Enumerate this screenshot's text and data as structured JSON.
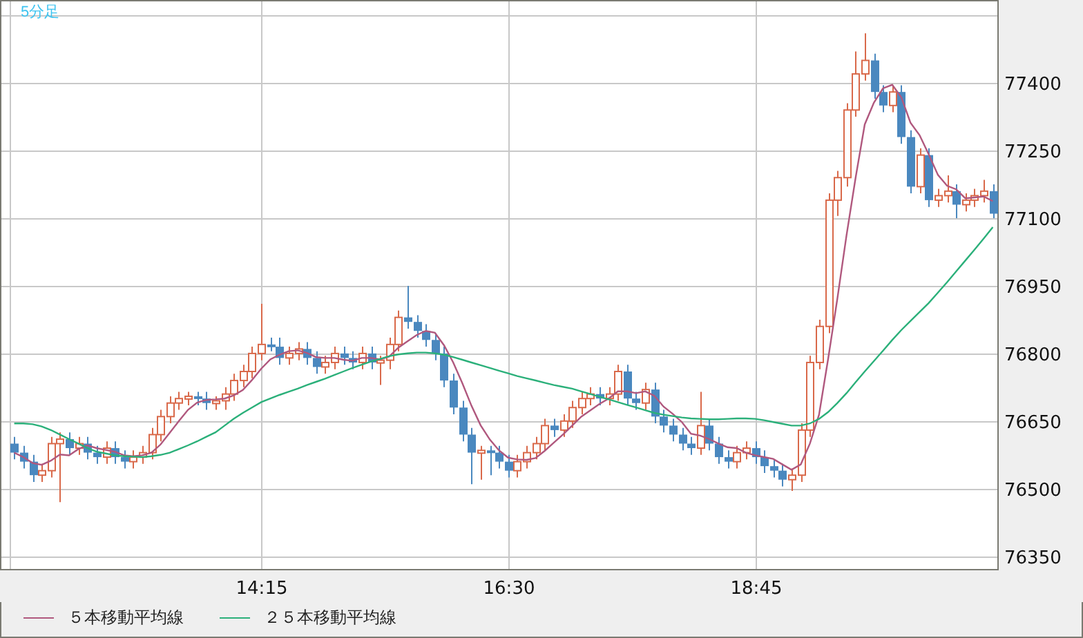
{
  "timeframe": "5分足",
  "chart_data": {
    "type": "candlestick",
    "grid": true,
    "ylim": [
      76322,
      77584
    ],
    "yticks": [
      76350,
      76500,
      76650,
      76800,
      76950,
      77100,
      77250,
      77400
    ],
    "categories": [
      null,
      null,
      null,
      null,
      null,
      null,
      null,
      null,
      null,
      null,
      null,
      null,
      null,
      null,
      null,
      null,
      null,
      null,
      null,
      null,
      null,
      null,
      null,
      null,
      null,
      null,
      null,
      "14:15",
      null,
      null,
      null,
      null,
      null,
      null,
      null,
      null,
      null,
      null,
      null,
      null,
      null,
      null,
      null,
      null,
      null,
      null,
      null,
      null,
      null,
      null,
      null,
      null,
      null,
      null,
      "16:30",
      null,
      null,
      null,
      null,
      null,
      null,
      null,
      null,
      null,
      null,
      null,
      null,
      null,
      null,
      null,
      null,
      null,
      null,
      null,
      null,
      null,
      null,
      null,
      null,
      null,
      null,
      "18:45",
      null,
      null,
      null,
      null,
      null,
      null,
      null,
      null,
      null,
      null,
      null,
      null,
      null,
      null,
      null,
      null,
      null,
      null,
      null,
      null,
      null,
      null,
      null,
      null,
      null,
      null
    ],
    "series": [
      {
        "name": "５本移動平均線",
        "type": "line",
        "color": "#b0587e",
        "values": [
          76580,
          76570,
          76557,
          76553,
          76562,
          76576,
          76574,
          76588,
          76596,
          76590,
          76586,
          76582,
          76574,
          76572,
          76574,
          76580,
          76598,
          76624,
          76650,
          76675,
          76691,
          76697,
          76698,
          76700,
          76707,
          76719,
          76741,
          76766,
          76787,
          76797,
          76805,
          76807,
          76801,
          76792,
          76790,
          76790,
          76786,
          76784,
          76790,
          76790,
          76787,
          76793,
          76813,
          76827,
          76841,
          76850,
          76846,
          76818,
          76780,
          76734,
          76684,
          76641,
          76609,
          76585,
          76569,
          76565,
          76564,
          76568,
          76584,
          76602,
          76620,
          76640,
          76660,
          76674,
          76688,
          76700,
          76716,
          76716,
          76712,
          76716,
          76706,
          76682,
          76666,
          76648,
          76622,
          76618,
          76610,
          76600,
          76592,
          76590,
          76580,
          76574,
          76570,
          76566,
          76554,
          76542,
          76554,
          76600,
          76664,
          76788,
          76920,
          77062,
          77190,
          77308,
          77356,
          77388,
          77396,
          77368,
          77312,
          77284,
          77242,
          77196,
          77172,
          77164,
          77144,
          77146,
          77148,
          77138
        ]
      },
      {
        "name": "２５本移動平均線",
        "type": "line",
        "color": "#2bb07a",
        "values": [
          76645,
          76645,
          76643,
          76638,
          76630,
          76620,
          76610,
          76600,
          76590,
          76582,
          76578,
          76574,
          76572,
          76571,
          76570,
          76572,
          76575,
          76580,
          76588,
          76596,
          76605,
          76615,
          76625,
          76640,
          76655,
          76668,
          76680,
          76692,
          76700,
          76708,
          76715,
          76722,
          76730,
          76737,
          76744,
          76752,
          76760,
          76768,
          76775,
          76782,
          76788,
          76794,
          76798,
          76800,
          76802,
          76802,
          76800,
          76797,
          76792,
          76786,
          76780,
          76774,
          76768,
          76762,
          76756,
          76750,
          76745,
          76740,
          76735,
          76730,
          76726,
          76722,
          76716,
          76710,
          76704,
          76698,
          76692,
          76686,
          76680,
          76674,
          76668,
          76664,
          76661,
          76658,
          76656,
          76655,
          76654,
          76654,
          76655,
          76656,
          76656,
          76655,
          76652,
          76648,
          76644,
          76640,
          76640,
          76645,
          76655,
          76670,
          76690,
          76712,
          76736,
          76760,
          76783,
          76806,
          76830,
          76852,
          76872,
          76892,
          76912,
          76935,
          76958,
          76982,
          77006,
          77030,
          77055,
          77080
        ]
      }
    ],
    "ohlc": [
      [
        76600,
        76615,
        76565,
        76580
      ],
      [
        76580,
        76595,
        76545,
        76560
      ],
      [
        76560,
        76575,
        76515,
        76530
      ],
      [
        76530,
        76555,
        76515,
        76540
      ],
      [
        76540,
        76615,
        76525,
        76600
      ],
      [
        76600,
        76625,
        76470,
        76610
      ],
      [
        76610,
        76625,
        76575,
        76590
      ],
      [
        76590,
        76615,
        76575,
        76600
      ],
      [
        76600,
        76615,
        76565,
        76580
      ],
      [
        76580,
        76595,
        76555,
        76570
      ],
      [
        76570,
        76605,
        76555,
        76590
      ],
      [
        76590,
        76605,
        76555,
        76570
      ],
      [
        76570,
        76585,
        76545,
        76560
      ],
      [
        76560,
        76585,
        76545,
        76570
      ],
      [
        76570,
        76595,
        76555,
        76580
      ],
      [
        76580,
        76635,
        76565,
        76620
      ],
      [
        76620,
        76675,
        76605,
        76660
      ],
      [
        76660,
        76705,
        76645,
        76690
      ],
      [
        76690,
        76715,
        76675,
        76700
      ],
      [
        76700,
        76715,
        76685,
        76705
      ],
      [
        76705,
        76715,
        76685,
        76700
      ],
      [
        76700,
        76715,
        76675,
        76690
      ],
      [
        76690,
        76705,
        76675,
        76695
      ],
      [
        76695,
        76725,
        76675,
        76710
      ],
      [
        76710,
        76755,
        76695,
        76740
      ],
      [
        76740,
        76775,
        76725,
        76760
      ],
      [
        76760,
        76815,
        76745,
        76800
      ],
      [
        76800,
        76910,
        76785,
        76820
      ],
      [
        76820,
        76835,
        76805,
        76815
      ],
      [
        76815,
        76835,
        76775,
        76790
      ],
      [
        76790,
        76815,
        76775,
        76800
      ],
      [
        76800,
        76825,
        76785,
        76810
      ],
      [
        76810,
        76825,
        76775,
        76790
      ],
      [
        76790,
        76805,
        76755,
        76770
      ],
      [
        76770,
        76795,
        76755,
        76780
      ],
      [
        76780,
        76815,
        76765,
        76800
      ],
      [
        76800,
        76815,
        76775,
        76790
      ],
      [
        76790,
        76805,
        76765,
        76780
      ],
      [
        76780,
        76815,
        76765,
        76800
      ],
      [
        76800,
        76815,
        76765,
        76780
      ],
      [
        76780,
        76795,
        76730,
        76785
      ],
      [
        76785,
        76835,
        76765,
        76820
      ],
      [
        76820,
        76895,
        76805,
        76880
      ],
      [
        76880,
        76950,
        76855,
        76870
      ],
      [
        76870,
        76885,
        76835,
        76850
      ],
      [
        76850,
        76865,
        76815,
        76830
      ],
      [
        76830,
        76845,
        76785,
        76800
      ],
      [
        76800,
        76815,
        76725,
        76740
      ],
      [
        76740,
        76755,
        76665,
        76680
      ],
      [
        76680,
        76695,
        76605,
        76620
      ],
      [
        76620,
        76635,
        76510,
        76580
      ],
      [
        76580,
        76595,
        76520,
        76585
      ],
      [
        76585,
        76595,
        76530,
        76580
      ],
      [
        76580,
        76595,
        76545,
        76560
      ],
      [
        76560,
        76575,
        76525,
        76540
      ],
      [
        76540,
        76575,
        76525,
        76560
      ],
      [
        76560,
        76595,
        76545,
        76580
      ],
      [
        76580,
        76615,
        76565,
        76600
      ],
      [
        76600,
        76655,
        76585,
        76640
      ],
      [
        76640,
        76655,
        76615,
        76630
      ],
      [
        76630,
        76665,
        76615,
        76650
      ],
      [
        76650,
        76695,
        76635,
        76680
      ],
      [
        76680,
        76715,
        76665,
        76700
      ],
      [
        76700,
        76725,
        76685,
        76710
      ],
      [
        76710,
        76725,
        76685,
        76700
      ],
      [
        76700,
        76725,
        76685,
        76710
      ],
      [
        76710,
        76775,
        76695,
        76760
      ],
      [
        76760,
        76775,
        76685,
        76700
      ],
      [
        76700,
        76715,
        76675,
        76690
      ],
      [
        76690,
        76735,
        76675,
        76720
      ],
      [
        76720,
        76735,
        76645,
        76660
      ],
      [
        76660,
        76675,
        76625,
        76640
      ],
      [
        76640,
        76655,
        76605,
        76620
      ],
      [
        76620,
        76635,
        76585,
        76600
      ],
      [
        76600,
        76615,
        76575,
        76590
      ],
      [
        76590,
        76715,
        76575,
        76640
      ],
      [
        76640,
        76655,
        76585,
        76600
      ],
      [
        76600,
        76615,
        76555,
        76570
      ],
      [
        76570,
        76585,
        76545,
        76560
      ],
      [
        76560,
        76595,
        76545,
        76580
      ],
      [
        76580,
        76605,
        76565,
        76590
      ],
      [
        76590,
        76605,
        76555,
        76570
      ],
      [
        76570,
        76585,
        76535,
        76550
      ],
      [
        76550,
        76565,
        76525,
        76540
      ],
      [
        76540,
        76555,
        76505,
        76520
      ],
      [
        76520,
        76545,
        76495,
        76530
      ],
      [
        76530,
        76645,
        76515,
        76630
      ],
      [
        76630,
        76795,
        76615,
        76780
      ],
      [
        76780,
        76875,
        76765,
        76860
      ],
      [
        76860,
        77155,
        76845,
        77140
      ],
      [
        77140,
        77205,
        77105,
        77190
      ],
      [
        77190,
        77355,
        77170,
        77340
      ],
      [
        77340,
        77470,
        77325,
        77420
      ],
      [
        77420,
        77510,
        77405,
        77450
      ],
      [
        77450,
        77465,
        77365,
        77380
      ],
      [
        77380,
        77395,
        77335,
        77350
      ],
      [
        77350,
        77395,
        77335,
        77380
      ],
      [
        77380,
        77395,
        77265,
        77280
      ],
      [
        77280,
        77295,
        77155,
        77170
      ],
      [
        77170,
        77255,
        77155,
        77240
      ],
      [
        77240,
        77255,
        77125,
        77140
      ],
      [
        77140,
        77165,
        77125,
        77150
      ],
      [
        77150,
        77195,
        77135,
        77160
      ],
      [
        77160,
        77175,
        77100,
        77130
      ],
      [
        77130,
        77155,
        77115,
        77140
      ],
      [
        77140,
        77165,
        77125,
        77150
      ],
      [
        77150,
        77185,
        77135,
        77160
      ],
      [
        77160,
        77175,
        77100,
        77110
      ]
    ]
  }
}
